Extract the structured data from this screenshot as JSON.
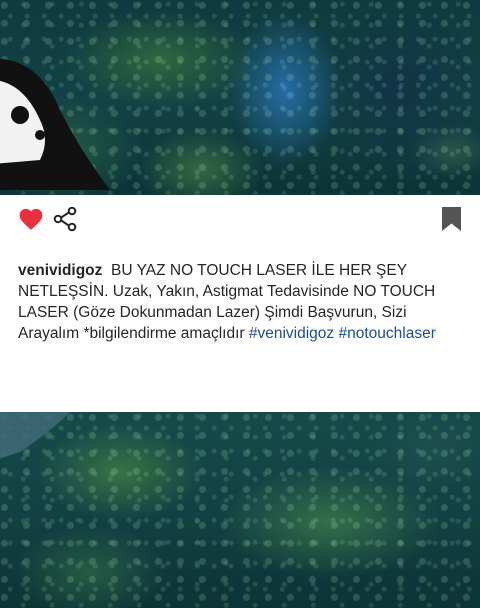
{
  "post": {
    "username": "venividigoz",
    "caption_text": "BU YAZ NO TOUCH LASER İLE HER ŞEY NETLEŞSİN. Uzak, Yakın, Astigmat Tedavisinde NO TOUCH LASER (Göze Dokunmadan Lazer) Şimdi Başvurun, Sizi Arayalım *bilgilendirme amaçlıdır",
    "hashtags": [
      "#venividigoz",
      "#notouchlaser"
    ]
  },
  "actions": {
    "like_icon": "heart-icon",
    "share_icon": "share-icon",
    "save_icon": "bookmark-icon"
  },
  "colors": {
    "like_red": "#e8303f",
    "hashtag_blue": "#1e4e8c",
    "text": "#262626",
    "bookmark_gray": "#555555"
  }
}
